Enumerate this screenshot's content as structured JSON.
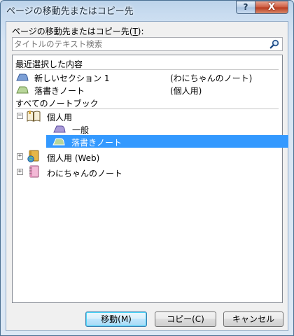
{
  "window": {
    "title": "ページの移動先またはコピー先",
    "help_glyph": "?",
    "close_glyph": "X"
  },
  "destination": {
    "label_prefix": "ページの移動先またはコピー先(",
    "label_key": "T",
    "label_suffix": "):"
  },
  "search": {
    "placeholder": "タイトルのテキスト検索",
    "icon": "search-icon"
  },
  "recent": {
    "header": "最近選択した内容",
    "items": [
      {
        "label": "新しいセクション 1",
        "notebook": "(わにちゃんのノート)",
        "color": "#7b9fd6"
      },
      {
        "label": "落書きノート",
        "notebook": "(個人用)",
        "color": "#b8d69a"
      }
    ]
  },
  "all": {
    "header": "すべてのノートブック",
    "notebooks": [
      {
        "label": "個人用",
        "expanded": true,
        "expander": "−",
        "icon": "open-notebook-icon",
        "sections": [
          {
            "label": "一般",
            "color": "#a99ad8",
            "selected": false
          },
          {
            "label": "落書きノート",
            "color": "#b8d69a",
            "selected": true
          }
        ]
      },
      {
        "label": "個人用 (Web)",
        "expanded": false,
        "expander": "+",
        "icon": "web-notebook-icon"
      },
      {
        "label": "わにちゃんのノート",
        "expanded": false,
        "expander": "+",
        "icon": "pink-notebook-icon"
      }
    ]
  },
  "buttons": {
    "move": "移動(M)",
    "copy": "コピー(C)",
    "cancel": "キャンセル"
  },
  "colors": {
    "selection": "#3399ff",
    "title_gradient": "#bcd3ea",
    "close_red": "#cc5a40"
  }
}
